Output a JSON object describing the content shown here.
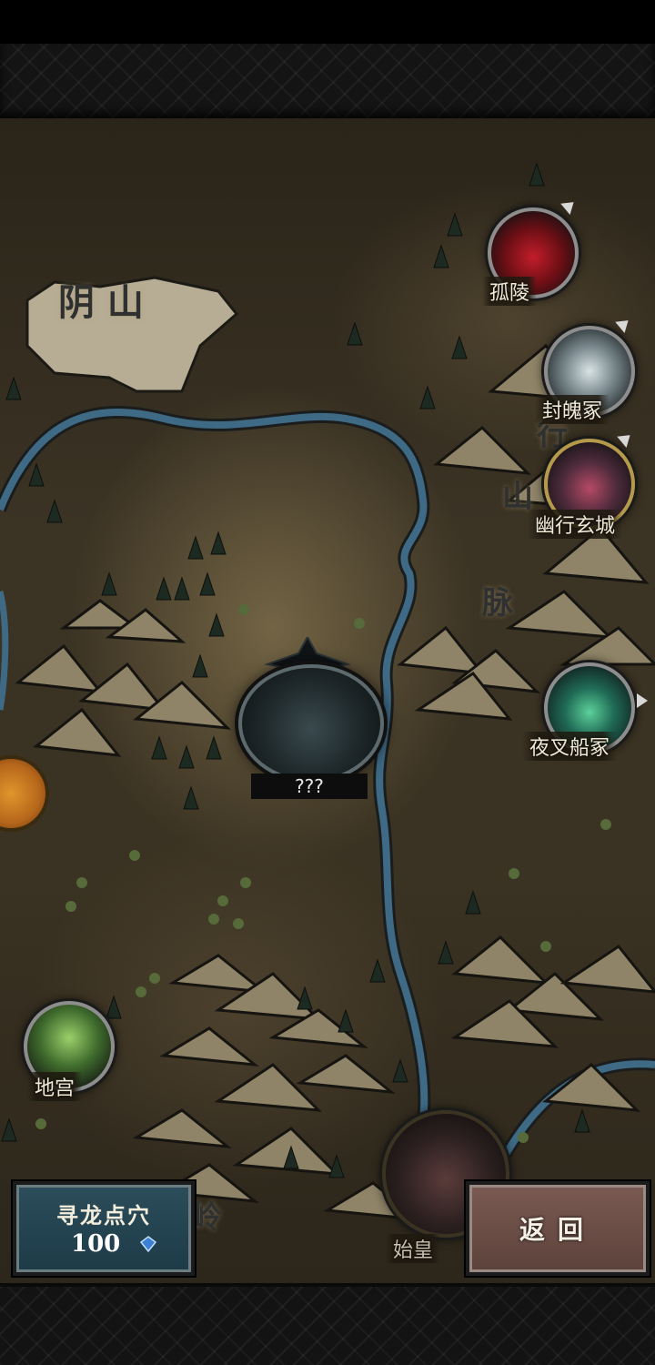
{
  "map": {
    "regions": {
      "yinshan": "阴 山",
      "mountain_range_1": "行",
      "mountain_range_2": "山",
      "mountain_range_3": "脉",
      "ling": "岭"
    },
    "locations": [
      {
        "id": "guling",
        "label": "孤陵"
      },
      {
        "id": "fengkuizhong",
        "label": "封魄冢"
      },
      {
        "id": "youxingxuancheng",
        "label": "幽行玄城"
      },
      {
        "id": "yechachuanzhong",
        "label": "夜叉船冢"
      },
      {
        "id": "digong",
        "label": "地宫"
      },
      {
        "id": "shihuang",
        "label": "始皇"
      }
    ],
    "current": {
      "label": "???"
    }
  },
  "actions": {
    "find_dragon": {
      "label": "寻龙点穴",
      "cost": "100",
      "currency_icon": "blue-gem-icon"
    },
    "back": {
      "label": "返回"
    }
  },
  "colors": {
    "river": "#3e6a86",
    "parchment": "#3a3222",
    "find_button": "#2c4d5b",
    "back_button": "#7a5a52"
  }
}
